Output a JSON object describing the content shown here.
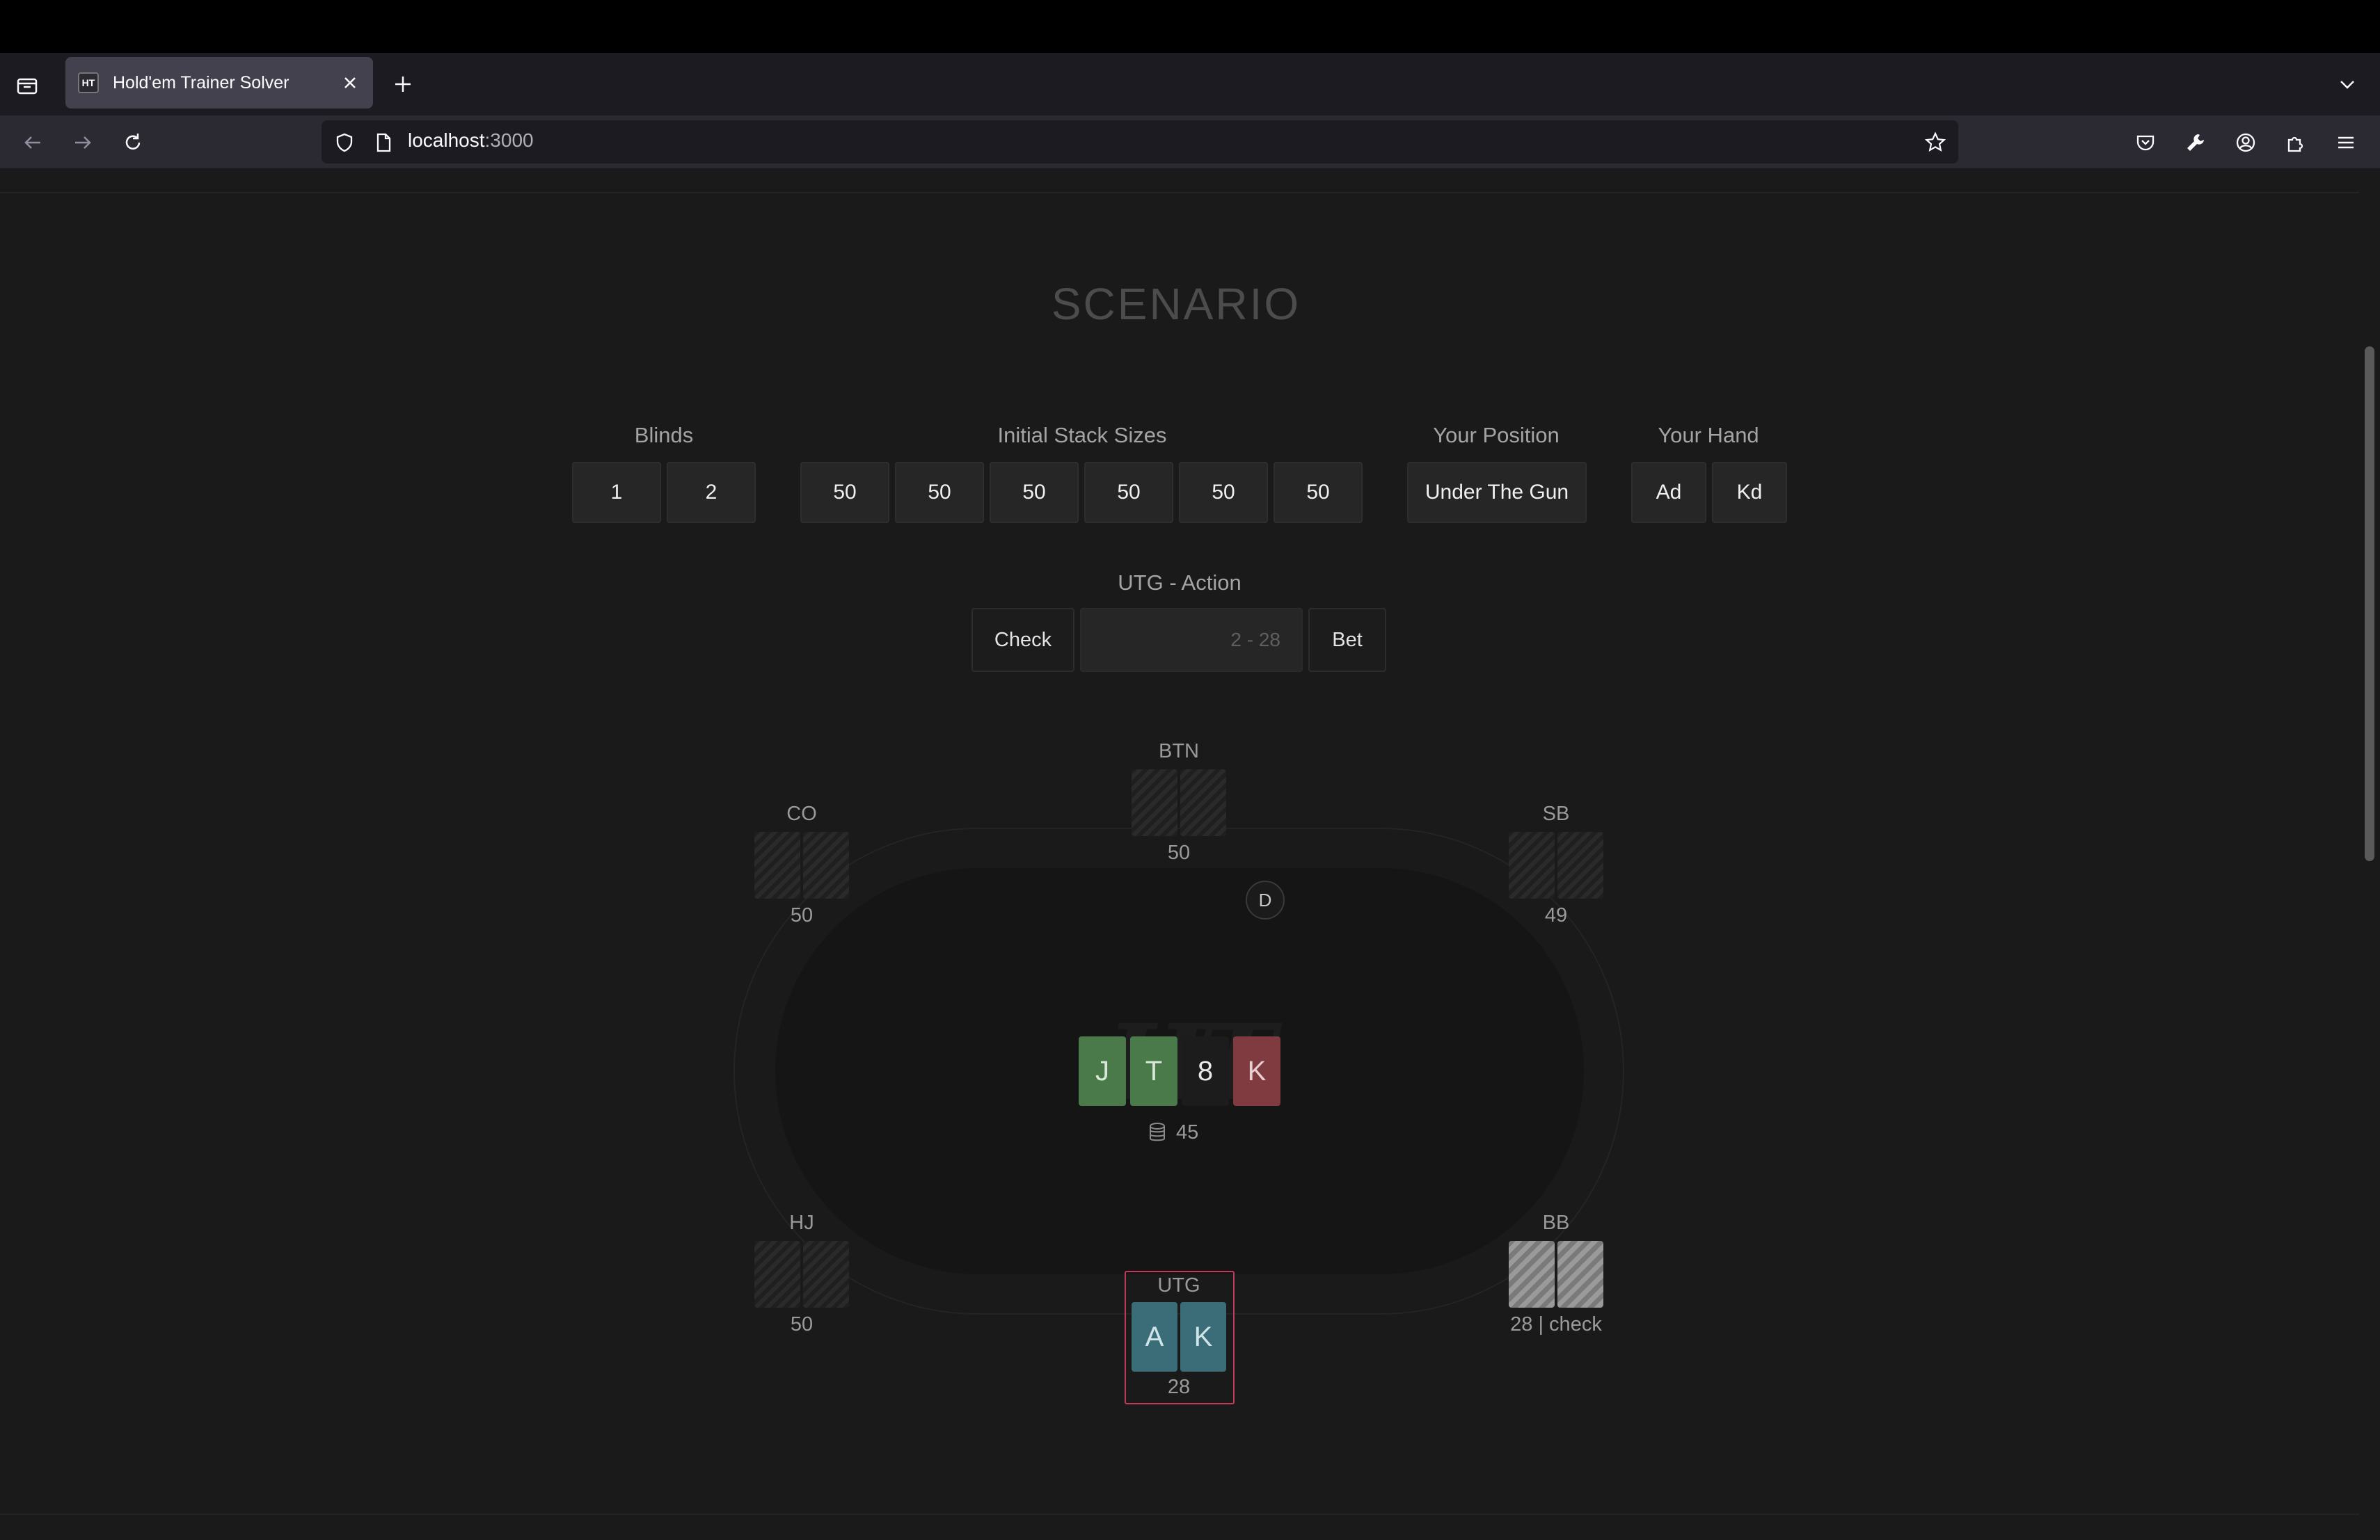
{
  "browser": {
    "tab_title": "Hold'em Trainer Solver",
    "tab_favicon": "HT",
    "url_host": "localhost",
    "url_port": ":3000"
  },
  "page": {
    "heading": "SCENARIO",
    "blinds": {
      "label": "Blinds",
      "values": [
        "1",
        "2"
      ]
    },
    "stacks": {
      "label": "Initial Stack Sizes",
      "values": [
        "50",
        "50",
        "50",
        "50",
        "50",
        "50"
      ]
    },
    "position": {
      "label": "Your Position",
      "value": "Under The Gun"
    },
    "hand": {
      "label": "Your Hand",
      "cards": [
        "Ad",
        "Kd"
      ]
    },
    "action": {
      "label": "UTG - Action",
      "check": "Check",
      "bet_placeholder": "2 - 28",
      "bet": "Bet"
    }
  },
  "table": {
    "dealer": "D",
    "seats": {
      "btn": {
        "label": "BTN",
        "stack": "50"
      },
      "co": {
        "label": "CO",
        "stack": "50"
      },
      "sb": {
        "label": "SB",
        "stack": "49"
      },
      "hj": {
        "label": "HJ",
        "stack": "50"
      },
      "bb": {
        "label": "BB",
        "stack": "28 | check"
      },
      "utg": {
        "label": "UTG",
        "stack": "28",
        "cards": [
          "A",
          "K"
        ]
      }
    },
    "board": [
      "J",
      "T",
      "8",
      "K"
    ],
    "board_colors": [
      "#4a7a4a",
      "#4a7a4a",
      "#1c1c1c",
      "#7f3b3f"
    ],
    "pot": "45",
    "hero_card_color": "#3b6d78",
    "hero_border_color": "#c23a5a"
  }
}
